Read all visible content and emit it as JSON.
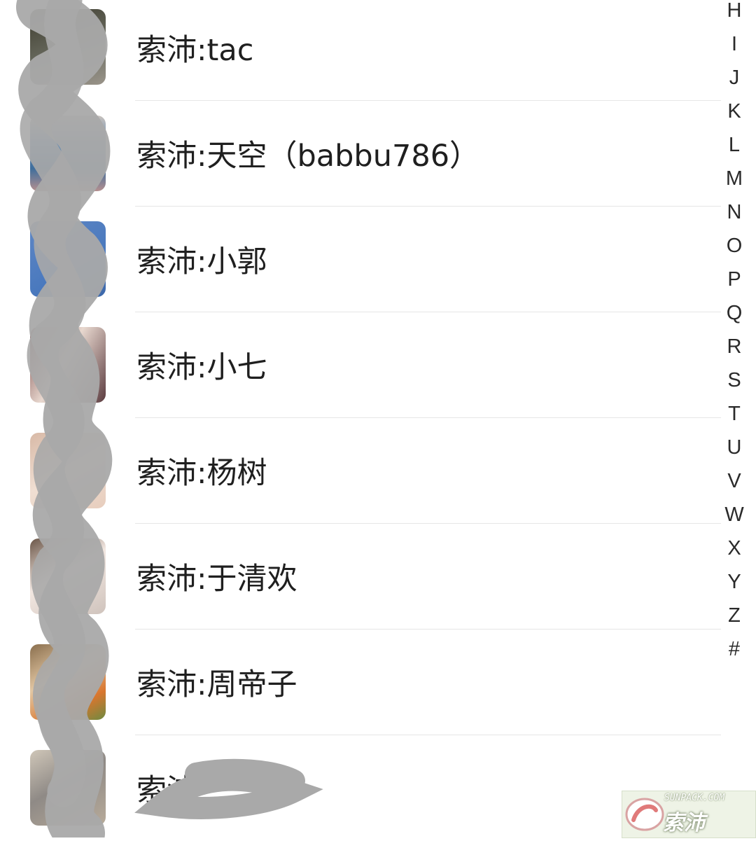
{
  "contacts": [
    {
      "name": "索沛:tac",
      "avatar": "avatar-photo"
    },
    {
      "name": "索沛:天空（babbu786）",
      "avatar": "avatar-photo"
    },
    {
      "name": "索沛:小郭",
      "avatar": "avatar-photo"
    },
    {
      "name": "索沛:小七",
      "avatar": "avatar-photo"
    },
    {
      "name": "索沛:杨树",
      "avatar": "avatar-photo"
    },
    {
      "name": "索沛:于清欢",
      "avatar": "avatar-photo"
    },
    {
      "name": "索沛:周帝子",
      "avatar": "avatar-photo"
    },
    {
      "name": "索沛",
      "avatar": "avatar-photo"
    }
  ],
  "index_letters": [
    "H",
    "I",
    "J",
    "K",
    "L",
    "M",
    "N",
    "O",
    "P",
    "Q",
    "R",
    "S",
    "T",
    "U",
    "V",
    "W",
    "X",
    "Y",
    "Z",
    "#"
  ],
  "watermark": {
    "top": "SUNPACK.COM",
    "main": "索沛"
  },
  "colors": {
    "divider": "#e6e6e6",
    "scribble": "#a9a9a9",
    "text": "#1f1f1f"
  }
}
